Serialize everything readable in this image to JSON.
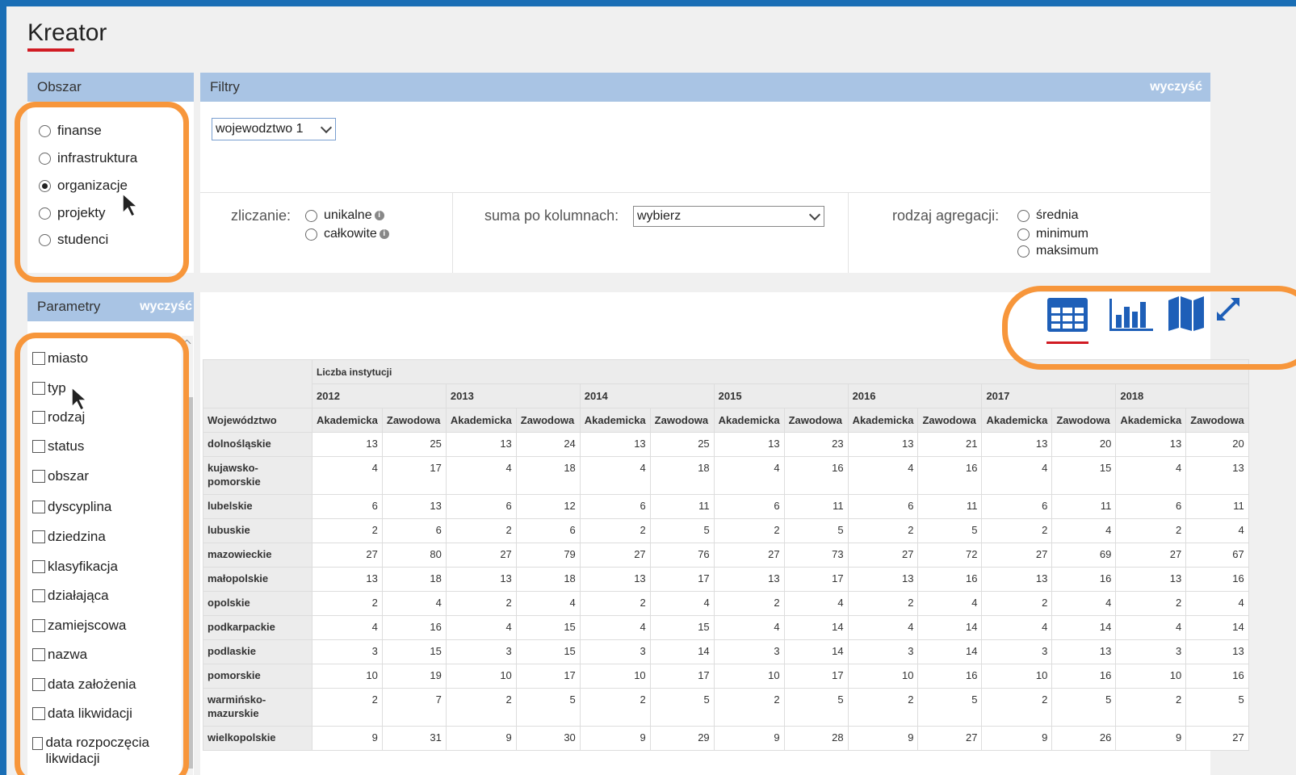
{
  "title": "Kreator",
  "obszar": {
    "header": "Obszar",
    "options": [
      "finanse",
      "infrastruktura",
      "organizacje",
      "projekty",
      "studenci"
    ],
    "selected": "organizacje"
  },
  "filtry": {
    "header": "Filtry",
    "clear": "wyczyść",
    "voivodeship_select": "wojewodztwo 1",
    "zliczanie_label": "zliczanie:",
    "zliczanie_options": [
      "unikalne",
      "całkowite"
    ],
    "suma_label": "suma po kolumnach:",
    "suma_value": "wybierz",
    "agregacja_label": "rodzaj agregacji:",
    "agregacja_options": [
      "średnia",
      "minimum",
      "maksimum"
    ]
  },
  "parametry": {
    "header": "Parametry",
    "clear": "wyczyść",
    "items": [
      "miasto",
      "typ",
      "rodzaj",
      "status",
      "obszar",
      "dyscyplina",
      "dziedzina",
      "klasyfikacja",
      "działająca",
      "zamiejscowa",
      "nazwa",
      "data założenia",
      "data likwidacji",
      "data rozpoczęcia likwidacji"
    ]
  },
  "view_icons": [
    "table-view-icon",
    "bar-chart-icon",
    "map-icon",
    "expand-icon"
  ],
  "table": {
    "measure": "Liczba instytucji",
    "years": [
      "2012",
      "2013",
      "2014",
      "2015",
      "2016",
      "2017",
      "2018"
    ],
    "sub_headers": [
      "Akademicka",
      "Zawodowa"
    ],
    "row_header": "Województwo",
    "rows": [
      {
        "name": "dolnośląskie",
        "values": [
          "13",
          "25",
          "13",
          "24",
          "13",
          "25",
          "13",
          "23",
          "13",
          "21",
          "13",
          "20",
          "13",
          "20"
        ]
      },
      {
        "name": "kujawsko-pomorskie",
        "values": [
          "4",
          "17",
          "4",
          "18",
          "4",
          "18",
          "4",
          "16",
          "4",
          "16",
          "4",
          "15",
          "4",
          "13"
        ]
      },
      {
        "name": "lubelskie",
        "values": [
          "6",
          "13",
          "6",
          "12",
          "6",
          "11",
          "6",
          "11",
          "6",
          "11",
          "6",
          "11",
          "6",
          "11"
        ]
      },
      {
        "name": "lubuskie",
        "values": [
          "2",
          "6",
          "2",
          "6",
          "2",
          "5",
          "2",
          "5",
          "2",
          "5",
          "2",
          "4",
          "2",
          "4"
        ]
      },
      {
        "name": "mazowieckie",
        "values": [
          "27",
          "80",
          "27",
          "79",
          "27",
          "76",
          "27",
          "73",
          "27",
          "72",
          "27",
          "69",
          "27",
          "67"
        ]
      },
      {
        "name": "małopolskie",
        "values": [
          "13",
          "18",
          "13",
          "18",
          "13",
          "17",
          "13",
          "17",
          "13",
          "16",
          "13",
          "16",
          "13",
          "16"
        ]
      },
      {
        "name": "opolskie",
        "values": [
          "2",
          "4",
          "2",
          "4",
          "2",
          "4",
          "2",
          "4",
          "2",
          "4",
          "2",
          "4",
          "2",
          "4"
        ]
      },
      {
        "name": "podkarpackie",
        "values": [
          "4",
          "16",
          "4",
          "15",
          "4",
          "15",
          "4",
          "14",
          "4",
          "14",
          "4",
          "14",
          "4",
          "14"
        ]
      },
      {
        "name": "podlaskie",
        "values": [
          "3",
          "15",
          "3",
          "15",
          "3",
          "14",
          "3",
          "14",
          "3",
          "14",
          "3",
          "13",
          "3",
          "13"
        ]
      },
      {
        "name": "pomorskie",
        "values": [
          "10",
          "19",
          "10",
          "17",
          "10",
          "17",
          "10",
          "17",
          "10",
          "16",
          "10",
          "16",
          "10",
          "16"
        ]
      },
      {
        "name": "warmińsko-mazurskie",
        "values": [
          "2",
          "7",
          "2",
          "5",
          "2",
          "5",
          "2",
          "5",
          "2",
          "5",
          "2",
          "5",
          "2",
          "5"
        ]
      },
      {
        "name": "wielkopolskie",
        "values": [
          "9",
          "31",
          "9",
          "30",
          "9",
          "29",
          "9",
          "28",
          "9",
          "27",
          "9",
          "26",
          "9",
          "27"
        ]
      }
    ]
  },
  "colors": {
    "accent": "#1a6eb5",
    "header_bg": "#a9c4e4",
    "highlight": "#f7963b",
    "active_underline": "#d11b23",
    "icon_blue": "#1e5fb8"
  }
}
